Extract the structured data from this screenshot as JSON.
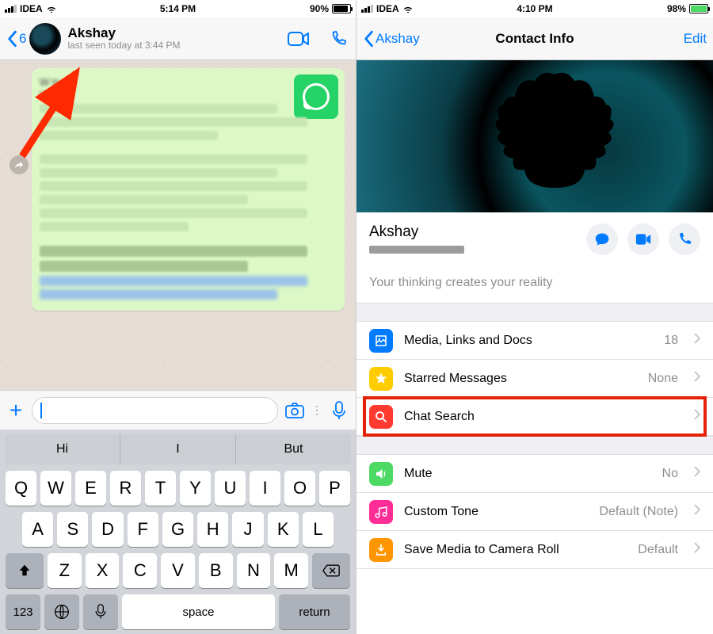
{
  "left": {
    "status": {
      "carrier": "IDEA",
      "time": "5:14 PM",
      "battery_pct": "90%",
      "battery_fill": 90
    },
    "nav": {
      "back_count": "6",
      "contact_name": "Akshay",
      "last_seen": "last seen today at 3:44 PM"
    },
    "bubble": {
      "head": "W  ts",
      "head2": "mess"
    },
    "input": {
      "placeholder": ""
    },
    "keyboard": {
      "suggestions": [
        "Hi",
        "I",
        "But"
      ],
      "row1": [
        "Q",
        "W",
        "E",
        "R",
        "T",
        "Y",
        "U",
        "I",
        "O",
        "P"
      ],
      "row2": [
        "A",
        "S",
        "D",
        "F",
        "G",
        "H",
        "J",
        "K",
        "L"
      ],
      "row3": [
        "Z",
        "X",
        "C",
        "V",
        "B",
        "N",
        "M"
      ],
      "num_key": "123",
      "space": "space",
      "return": "return"
    }
  },
  "right": {
    "status": {
      "carrier": "IDEA",
      "time": "4:10 PM",
      "battery_pct": "98%",
      "battery_fill": 98
    },
    "nav": {
      "back_label": "Akshay",
      "title": "Contact Info",
      "edit": "Edit"
    },
    "contact": {
      "name": "Akshay",
      "about": "Your thinking creates your reality"
    },
    "cells": {
      "media": {
        "label": "Media, Links and Docs",
        "value": "18"
      },
      "starred": {
        "label": "Starred Messages",
        "value": "None"
      },
      "search": {
        "label": "Chat Search",
        "value": ""
      },
      "mute": {
        "label": "Mute",
        "value": "No"
      },
      "tone": {
        "label": "Custom Tone",
        "value": "Default (Note)"
      },
      "save": {
        "label": "Save Media to Camera Roll",
        "value": "Default"
      }
    }
  }
}
